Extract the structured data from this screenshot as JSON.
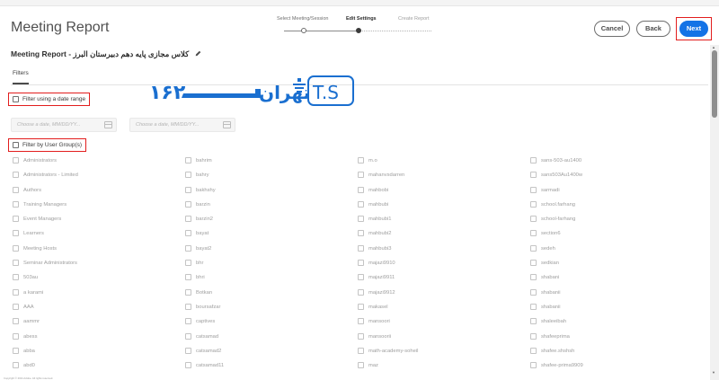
{
  "header": {
    "title": "Meeting Report",
    "steps": [
      {
        "label": "Select Meeting/Session",
        "state": "done"
      },
      {
        "label": "Edit Settings",
        "state": "active"
      },
      {
        "label": "Create Report",
        "state": "future"
      }
    ],
    "buttons": {
      "cancel": "Cancel",
      "back": "Back",
      "next": "Next"
    }
  },
  "report": {
    "subtitle": "Meeting Report - کلاس مجازی پایه دهم دبیرستان البرز",
    "edit_icon": "pencil-icon"
  },
  "tabs": [
    {
      "label": "Filters",
      "selected": true
    }
  ],
  "filters": {
    "date_range": {
      "label": "Filter using a date range",
      "checked": false
    },
    "start_placeholder": "Choose a date, MM/DD/YY...",
    "end_placeholder": "Choose a date, MM/DD/YY...",
    "user_groups": {
      "label": "Filter by User Group(s)",
      "checked": false
    }
  },
  "logo": {
    "text": "تهران ۱۶۲",
    "brand": "T.S",
    "color": "#1a6fd0"
  },
  "groups": {
    "columns": [
      [
        "Administrators",
        "Administrators - Limited",
        "Authors",
        "Training Managers",
        "Event Managers",
        "Learners",
        "Meeting Hosts",
        "Seminar Administrators",
        "503au",
        "a karami",
        "AAA",
        "aammr",
        "abess",
        "abba",
        "abd0"
      ],
      [
        "bahrim",
        "bahry",
        "bakhshy",
        "barzin",
        "barzin2",
        "bayat",
        "bayat2",
        "bhr",
        "bhri",
        "Botkan",
        "boursafzar",
        "captives",
        "catsamad",
        "catsamad2",
        "catsamad11"
      ],
      [
        "m.o",
        "mahanvsdarren",
        "mahbobi",
        "mahbubi",
        "mahbubi1",
        "mahbubi2",
        "mahbubi3",
        "majazi9910",
        "majazi9911",
        "majazi9912",
        "makasel",
        "mansoori",
        "mansoorii",
        "math-academy-soheil",
        "maz"
      ],
      [
        "sans-503-au1400",
        "sans503Au1400w",
        "sarmadi",
        "school.farhang",
        "school-farhang",
        "section6",
        "sedeh",
        "sedkian",
        "shabani",
        "shabanii",
        "shabanii",
        "shaleeibah",
        "shafeeprima",
        "shafee.shshsh",
        "shafee-prima9909"
      ]
    ]
  },
  "footer": {
    "copyright": "Copyright © 2021 Adobe. All rights reserved."
  },
  "colors": {
    "accent": "#1473e6",
    "highlight": "#e21d1d"
  }
}
